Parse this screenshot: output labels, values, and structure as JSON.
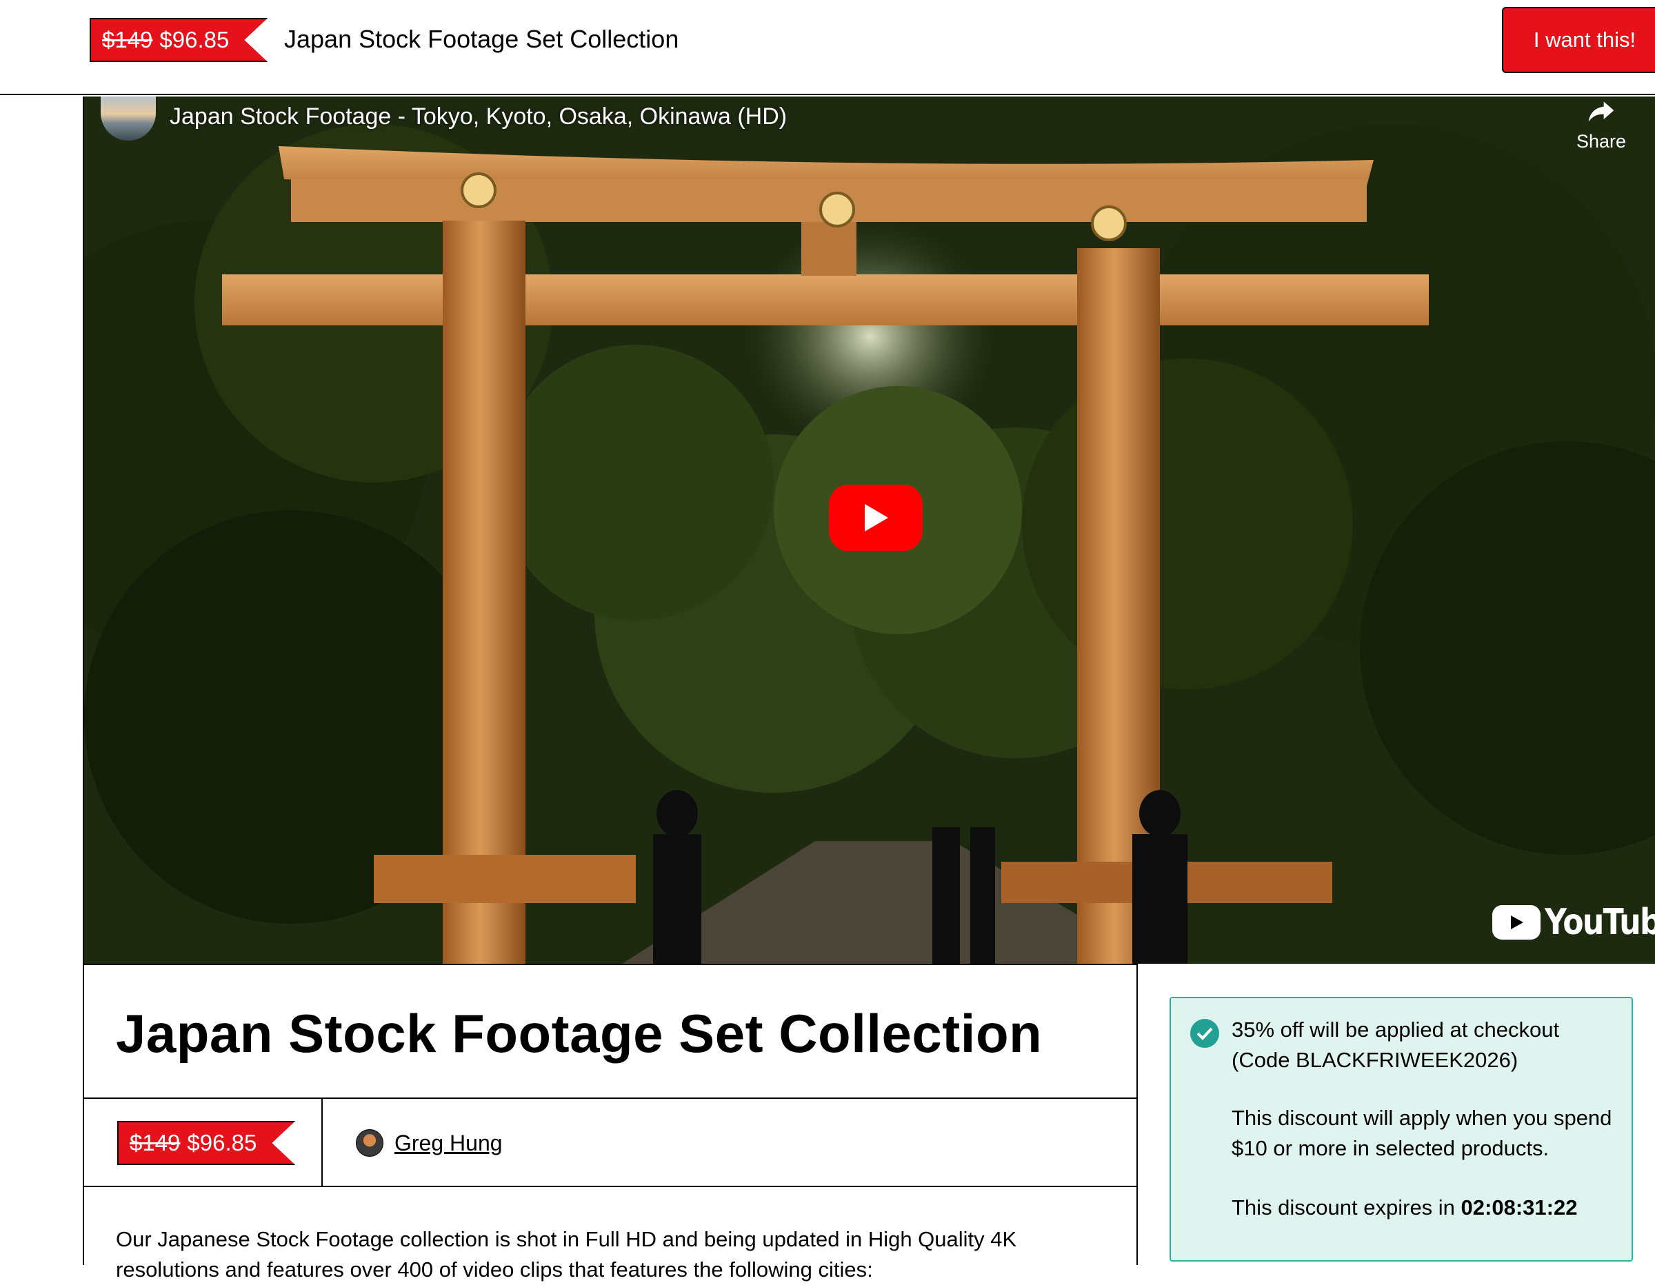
{
  "header": {
    "price_old": "$149",
    "price_new": "$96.85",
    "title": "Japan Stock Footage Set Collection",
    "cta_label": "I want this!"
  },
  "video": {
    "title": "Japan Stock Footage - Tokyo, Kyoto, Osaka, Okinawa (HD)",
    "share_label": "Share",
    "logo_text": "YouTube"
  },
  "product": {
    "title": "Japan Stock Footage Set Collection",
    "price_old": "$149",
    "price_new": "$96.85",
    "author": "Greg Hung",
    "description": "Our Japanese Stock Footage collection is shot in Full HD and being updated in High Quality 4K resolutions and features over 400 of video clips that features the following cities:"
  },
  "discount": {
    "line1": "35% off will be applied at checkout (Code BLACKFRIWEEK2026)",
    "line2": "This discount will apply when you spend $10 or more in selected products.",
    "expires_label": "This discount expires in",
    "expires_time": "02:08:31:22"
  },
  "colors": {
    "accent_red": "#e5121b",
    "discount_bg": "#dff3ef",
    "discount_border": "#3fa899",
    "check_green": "#23a094"
  }
}
